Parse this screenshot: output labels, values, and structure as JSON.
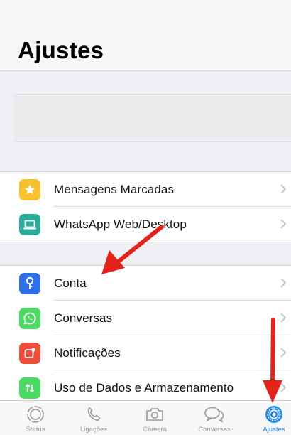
{
  "header": {
    "title": "Ajustes"
  },
  "groups": {
    "starred": [
      {
        "label": "Mensagens Marcadas",
        "icon": "star-icon",
        "color": "#f7c230"
      },
      {
        "label": "WhatsApp Web/Desktop",
        "icon": "laptop-icon",
        "color": "#2bac9a"
      }
    ],
    "settings": [
      {
        "label": "Conta",
        "icon": "key-icon",
        "color": "#2f6fe8"
      },
      {
        "label": "Conversas",
        "icon": "whatsapp-icon",
        "color": "#4cd964"
      },
      {
        "label": "Notificações",
        "icon": "notification-icon",
        "color": "#ef4e3a"
      },
      {
        "label": "Uso de Dados e Armazenamento",
        "icon": "data-arrows-icon",
        "color": "#4cd964"
      }
    ]
  },
  "tabbar": {
    "tabs": [
      {
        "label": "Status",
        "icon": "status-icon",
        "active": false
      },
      {
        "label": "Ligações",
        "icon": "phone-icon",
        "active": false
      },
      {
        "label": "Câmera",
        "icon": "camera-icon",
        "active": false
      },
      {
        "label": "Conversas",
        "icon": "chat-bubbles-icon",
        "active": false
      },
      {
        "label": "Ajustes",
        "icon": "gear-icon",
        "active": true
      }
    ],
    "active_color": "#1e88f5",
    "inactive_color": "#9a9a9e"
  },
  "annotations": {
    "arrow_color": "#e2231a"
  }
}
